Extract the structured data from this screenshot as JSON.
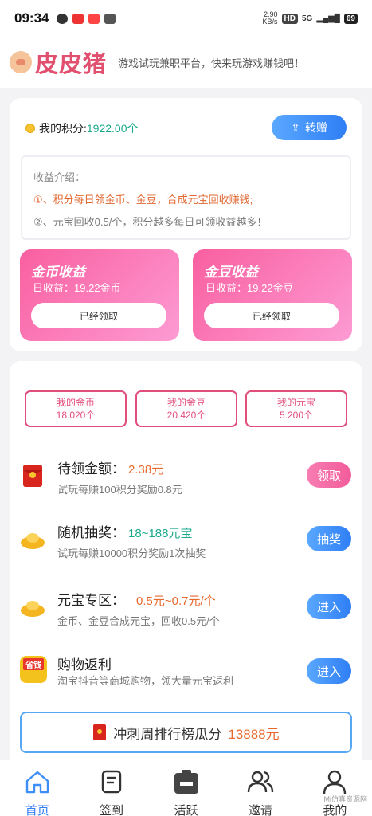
{
  "status": {
    "time": "09:34",
    "speed": "2.90\nKB/s",
    "hd": "HD",
    "net": "5G",
    "battery": "69"
  },
  "header": {
    "logo": "皮皮猪",
    "slogan": "游戏试玩兼职平台，快来玩游戏赚钱吧！"
  },
  "points": {
    "label": "我的积分:",
    "value": "1922.00个",
    "transfer_label": "转赠"
  },
  "intro": {
    "title": "收益介绍：",
    "line1": "①、积分每日领金币、金豆，合成元宝回收赚钱;",
    "line2": "②、元宝回收0.5/个，积分越多每日可领收益越多！"
  },
  "earnings": [
    {
      "title": "金币收益",
      "sub": "日收益：19.22金币",
      "button": "已经领取"
    },
    {
      "title": "金豆收益",
      "sub": "日收益：19.22金豆",
      "button": "已经领取"
    }
  ],
  "stats": [
    {
      "label": "我的金币",
      "value": "18.020个"
    },
    {
      "label": "我的金豆",
      "value": "20.420个"
    },
    {
      "label": "我的元宝",
      "value": "5.200个"
    }
  ],
  "rows": [
    {
      "name": "待领金额：",
      "amount": "2.38元",
      "desc": "试玩每赚100积分奖励0.8元",
      "button": "领取",
      "icon": "red-envelope-icon",
      "color": "#e8692d"
    },
    {
      "name": "随机抽奖：",
      "amount": "18~188元宝",
      "desc": "试玩每赚10000积分奖励1次抽奖",
      "button": "抽奖",
      "icon": "gold-ingot-icon",
      "color": "#1aa98b"
    },
    {
      "name": "元宝专区：",
      "amount": "0.5元~0.7元/个",
      "desc": "金币、金豆合成元宝，回收0.5元/个",
      "button": "进入",
      "icon": "gold-ingot-icon",
      "color": "#e8692d"
    },
    {
      "name": "购物返利",
      "amount": "",
      "desc": "淘宝抖音等商城购物，领大量元宝返利",
      "button": "进入",
      "icon": "shopping-app-icon",
      "color": "#e8692d"
    }
  ],
  "shopping_icon_text": "省钱",
  "rank": {
    "label": "冲刺周排行榜瓜分",
    "value": "13888元"
  },
  "tabs": [
    {
      "label": "首页",
      "icon": "home-icon"
    },
    {
      "label": "签到",
      "icon": "checkin-icon"
    },
    {
      "label": "活跃",
      "icon": "briefcase-icon"
    },
    {
      "label": "邀请",
      "icon": "users-icon"
    },
    {
      "label": "我的",
      "icon": "user-icon"
    }
  ],
  "watermark": "Mi仿真资源网",
  "colors": {
    "accent_blue": "#2f7ef5",
    "pink": "#f25c9a",
    "green": "#1aa98b",
    "orange": "#e8692d"
  }
}
